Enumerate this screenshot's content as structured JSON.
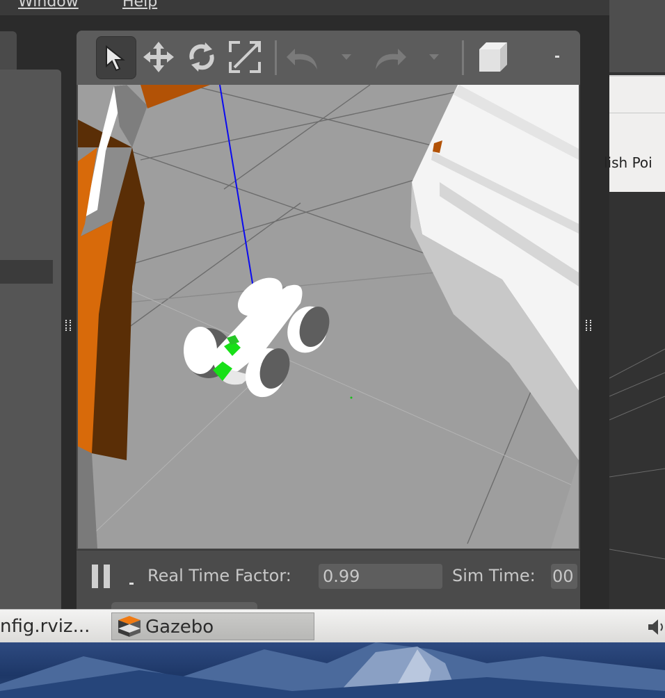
{
  "menubar": {
    "items": [
      {
        "label": "Window"
      },
      {
        "label": "Help"
      }
    ]
  },
  "background_window": {
    "partial_text": "lish Poi"
  },
  "toolbar": {
    "tools": [
      {
        "name": "select",
        "icon": "arrow-cursor-icon",
        "active": true
      },
      {
        "name": "translate",
        "icon": "move-arrows-icon"
      },
      {
        "name": "rotate",
        "icon": "rotate-icon"
      },
      {
        "name": "scale",
        "icon": "scale-icon"
      },
      {
        "name": "undo",
        "icon": "undo-icon"
      },
      {
        "name": "redo",
        "icon": "redo-icon"
      },
      {
        "name": "box",
        "icon": "box-icon"
      }
    ]
  },
  "status": {
    "rtf_label": "Real Time Factor:",
    "rtf_value": "0.99",
    "sim_time_label": "Sim Time:",
    "sim_time_value": "00"
  },
  "taskbar": {
    "tasks": [
      {
        "label": "nfig.rviz..."
      },
      {
        "label": "Gazebo",
        "active": true
      }
    ]
  },
  "colors": {
    "wall_orange": "#cc5a00",
    "wall_dark": "#5b2c06",
    "ground": "#9e9e9e",
    "robot": "#ffffff",
    "sensor_green": "#18e018",
    "axis_blue": "#0a0af0"
  }
}
